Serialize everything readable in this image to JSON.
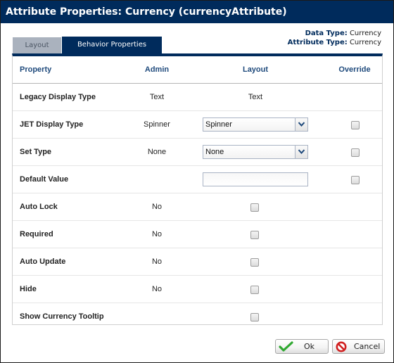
{
  "window": {
    "title": "Attribute Properties: Currency (currencyAttribute)"
  },
  "meta": {
    "data_type_label": "Data Type:",
    "data_type_value": "Currency",
    "attribute_type_label": "Attribute Type:",
    "attribute_type_value": "Currency"
  },
  "tabs": [
    {
      "label": "Layout",
      "active": false
    },
    {
      "label": "Behavior Properties",
      "active": true
    }
  ],
  "table": {
    "headers": {
      "property": "Property",
      "admin": "Admin",
      "layout": "Layout",
      "override": "Override"
    },
    "rows": [
      {
        "property": "Legacy Display Type",
        "admin": "Text",
        "layout": "Text"
      },
      {
        "property": "JET Display Type",
        "admin": "Spinner",
        "layout_select": "Spinner",
        "override_checked": false
      },
      {
        "property": "Set Type",
        "admin": "None",
        "layout_select": "None",
        "override_checked": false
      },
      {
        "property": "Default Value",
        "admin": "",
        "layout_input": "",
        "override_checked": false
      },
      {
        "property": "Auto Lock",
        "admin": "No",
        "layout_checked": false
      },
      {
        "property": "Required",
        "admin": "No",
        "layout_checked": false
      },
      {
        "property": "Auto Update",
        "admin": "No",
        "layout_checked": false
      },
      {
        "property": "Hide",
        "admin": "No",
        "layout_checked": false
      },
      {
        "property": "Show Currency Tooltip",
        "admin": "",
        "layout_checked": false
      }
    ]
  },
  "buttons": {
    "ok": "Ok",
    "cancel": "Cancel"
  },
  "colors": {
    "title_bar": "#002b5c",
    "header_text": "#1f4a7c",
    "inactive_tab": "#aab2be"
  }
}
